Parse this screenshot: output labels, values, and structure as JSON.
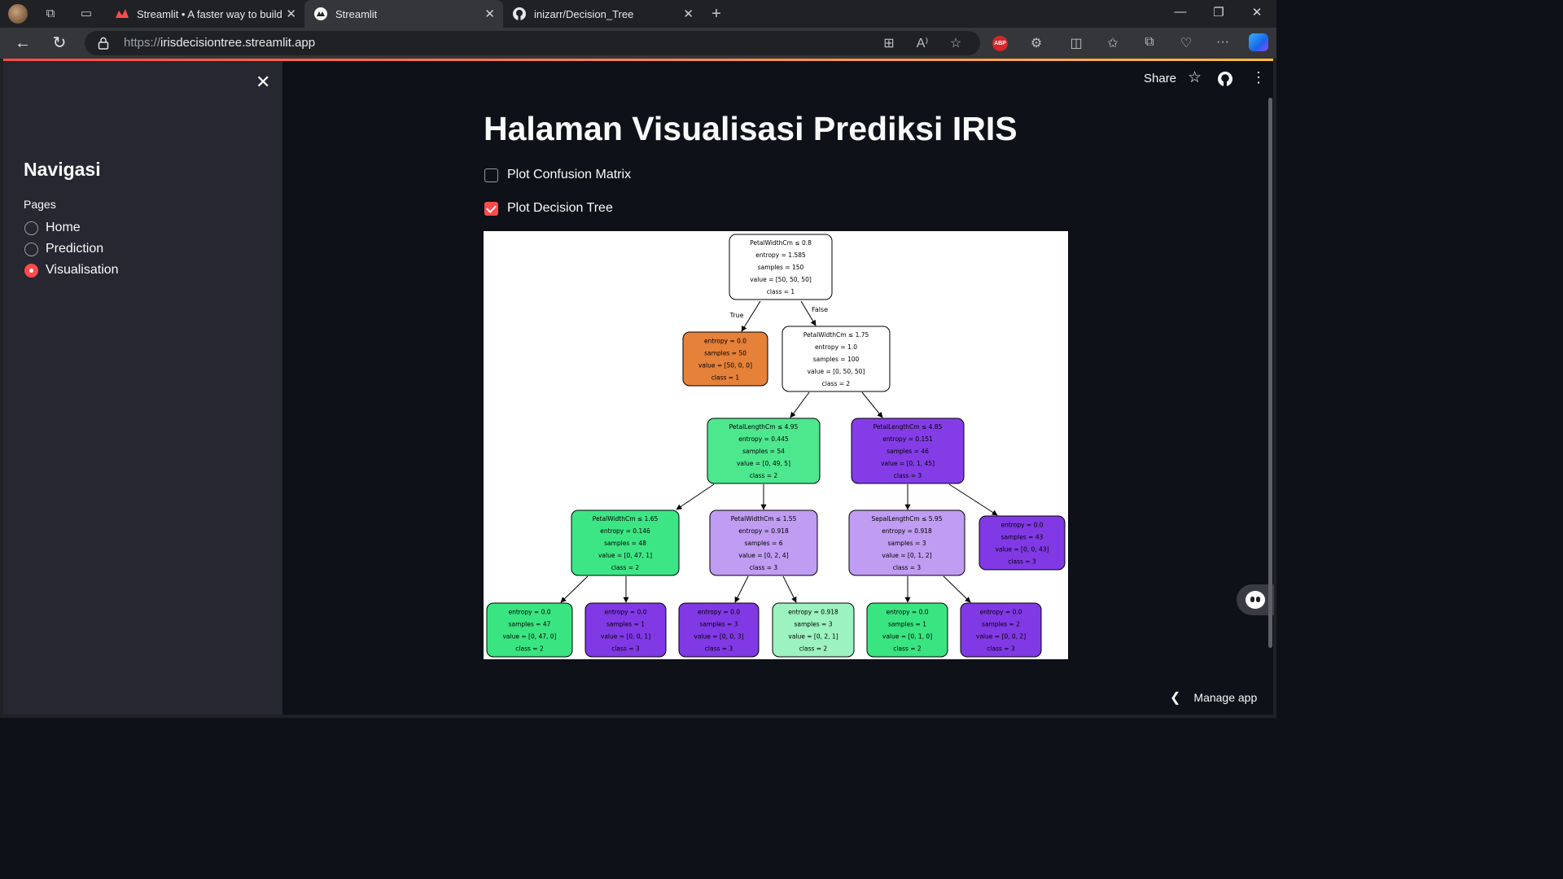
{
  "browser": {
    "tabs": [
      {
        "title": "Streamlit • A faster way to build a",
        "active": false
      },
      {
        "title": "Streamlit",
        "active": true
      },
      {
        "title": "inizarr/Decision_Tree",
        "active": false
      }
    ],
    "url_protocol": "https://",
    "url_host": "irisdecisiontree.streamlit.app",
    "abp_label": "ABP"
  },
  "sidebar": {
    "nav_title": "Navigasi",
    "pages_label": "Pages",
    "pages": [
      {
        "label": "Home",
        "selected": false
      },
      {
        "label": "Prediction",
        "selected": false
      },
      {
        "label": "Visualisation",
        "selected": true
      }
    ]
  },
  "header": {
    "share_label": "Share"
  },
  "main": {
    "title": "Halaman Visualisasi Prediksi IRIS",
    "checkboxes": [
      {
        "label": "Plot Confusion Matrix",
        "checked": false
      },
      {
        "label": "Plot Decision Tree",
        "checked": true
      }
    ],
    "manage_app_label": "Manage app"
  },
  "tree": {
    "edge_true": "True",
    "edge_false": "False",
    "nodes": [
      {
        "id": "n0",
        "lines": [
          "PetalWidthCm ≤ 0.8",
          "entropy = 1.585",
          "samples = 150",
          "value = [50, 50, 50]",
          "class = 1"
        ],
        "fill": "#ffffff"
      },
      {
        "id": "n1",
        "lines": [
          "entropy = 0.0",
          "samples = 50",
          "value = [50, 0, 0]",
          "class = 1"
        ],
        "fill": "#e58139"
      },
      {
        "id": "n2",
        "lines": [
          "PetalWidthCm ≤ 1.75",
          "entropy = 1.0",
          "samples = 100",
          "value = [0, 50, 50]",
          "class = 2"
        ],
        "fill": "#ffffff"
      },
      {
        "id": "n3",
        "lines": [
          "PetalLengthCm ≤ 4.95",
          "entropy = 0.445",
          "samples = 54",
          "value = [0, 49, 5]",
          "class = 2"
        ],
        "fill": "#4de88e"
      },
      {
        "id": "n4",
        "lines": [
          "PetalLengthCm ≤ 4.85",
          "entropy = 0.151",
          "samples = 46",
          "value = [0, 1, 45]",
          "class = 3"
        ],
        "fill": "#843de6"
      },
      {
        "id": "n5",
        "lines": [
          "PetalWidthCm ≤ 1.65",
          "entropy = 0.146",
          "samples = 48",
          "value = [0, 47, 1]",
          "class = 2"
        ],
        "fill": "#3de684"
      },
      {
        "id": "n6",
        "lines": [
          "PetalWidthCm ≤ 1.55",
          "entropy = 0.918",
          "samples = 6",
          "value = [0, 2, 4]",
          "class = 3"
        ],
        "fill": "#c09cf2"
      },
      {
        "id": "n7",
        "lines": [
          "SepalLengthCm ≤ 5.95",
          "entropy = 0.918",
          "samples = 3",
          "value = [0, 1, 2]",
          "class = 3"
        ],
        "fill": "#c09cf2"
      },
      {
        "id": "n8",
        "lines": [
          "entropy = 0.0",
          "samples = 43",
          "value = [0, 0, 43]",
          "class = 3"
        ],
        "fill": "#8139e5"
      },
      {
        "id": "n9",
        "lines": [
          "entropy = 0.0",
          "samples = 47",
          "value = [0, 47, 0]",
          "class = 2"
        ],
        "fill": "#39e581"
      },
      {
        "id": "n10",
        "lines": [
          "entropy = 0.0",
          "samples = 1",
          "value = [0, 0, 1]",
          "class = 3"
        ],
        "fill": "#8139e5"
      },
      {
        "id": "n11",
        "lines": [
          "entropy = 0.0",
          "samples = 3",
          "value = [0, 0, 3]",
          "class = 3"
        ],
        "fill": "#8139e5"
      },
      {
        "id": "n12",
        "lines": [
          "entropy = 0.918",
          "samples = 3",
          "value = [0, 2, 1]",
          "class = 2"
        ],
        "fill": "#9cf2c0"
      },
      {
        "id": "n13",
        "lines": [
          "entropy = 0.0",
          "samples = 1",
          "value = [0, 1, 0]",
          "class = 2"
        ],
        "fill": "#39e581"
      },
      {
        "id": "n14",
        "lines": [
          "entropy = 0.0",
          "samples = 2",
          "value = [0, 0, 2]",
          "class = 3"
        ],
        "fill": "#8139e5"
      }
    ]
  },
  "colors": {
    "accent": "#ff4b4b",
    "sidebar_bg": "#262730",
    "main_bg": "#0e1117"
  }
}
